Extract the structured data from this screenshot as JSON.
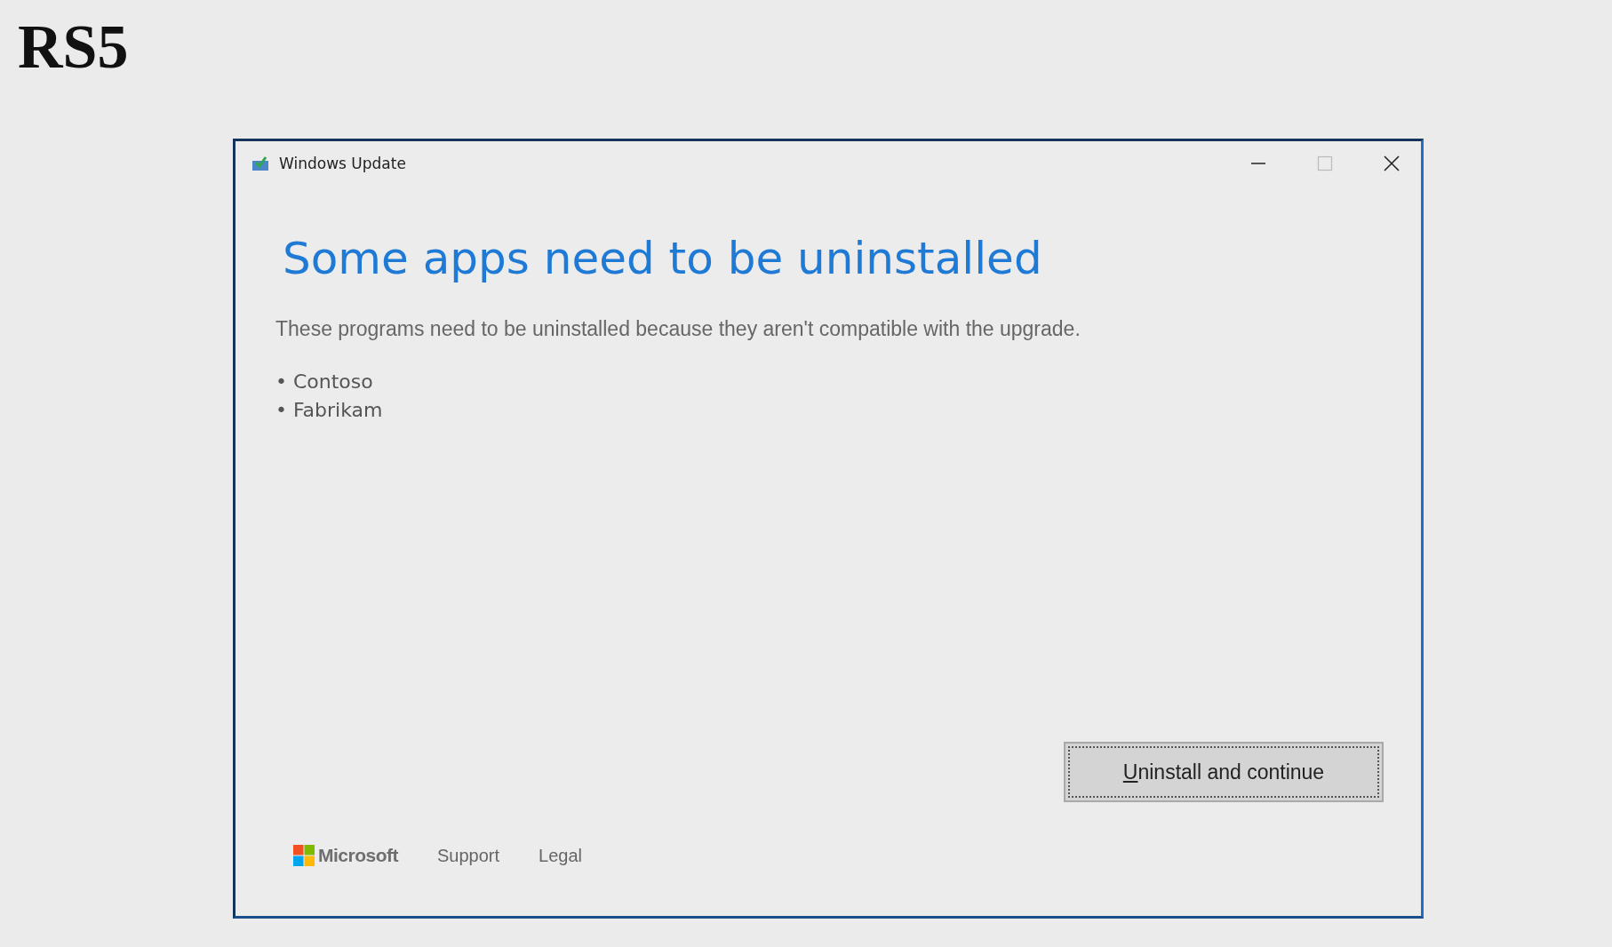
{
  "page_title": "RS5",
  "window": {
    "title": "Windows Update"
  },
  "heading": "Some apps need to be uninstalled",
  "description": "These programs need to be uninstalled because they aren't compatible with the upgrade.",
  "apps": [
    "• Contoso",
    "• Fabrikam"
  ],
  "primary_button": {
    "label": "Uninstall and continue",
    "first_letter_underlined": true
  },
  "footer": {
    "brand": "Microsoft",
    "links": [
      "Support",
      "Legal"
    ]
  }
}
